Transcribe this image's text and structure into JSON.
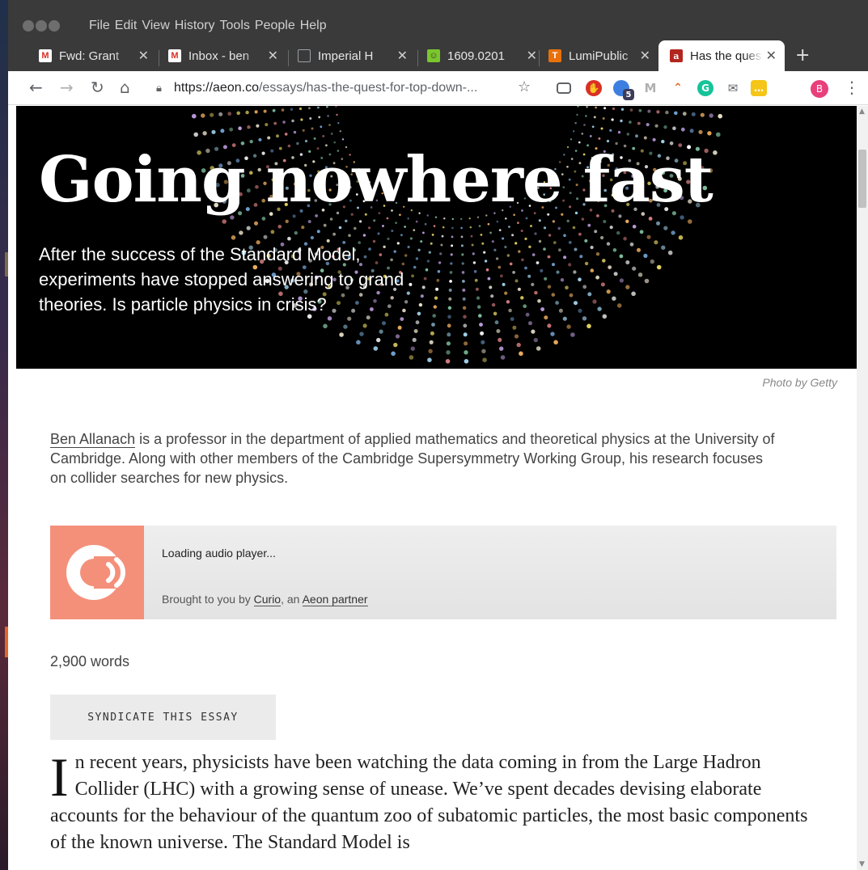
{
  "menu": [
    "File",
    "Edit",
    "View",
    "History",
    "Tools",
    "People",
    "Help"
  ],
  "tabs": [
    {
      "title": "Fwd: Grant",
      "icon": "gmail-icon",
      "color": "#d93025",
      "glyph": "M"
    },
    {
      "title": "Inbox - ben",
      "icon": "gmail-icon",
      "color": "#d93025",
      "glyph": "M"
    },
    {
      "title": "Imperial H",
      "icon": "document-icon",
      "color": "#9aa0a6",
      "glyph": ""
    },
    {
      "title": "1609.0201",
      "icon": "smiley-icon",
      "color": "#7bc62d",
      "glyph": ""
    },
    {
      "title": "LumiPublic",
      "icon": "lumi-icon",
      "color": "#e8710a",
      "glyph": "T"
    },
    {
      "title": "Has the quest",
      "icon": "aeon-icon",
      "color": "#b3261e",
      "glyph": "a"
    }
  ],
  "url": {
    "host": "https://aeon.co",
    "path": "/essays/has-the-quest-for-top-down-..."
  },
  "profile_initial": "B",
  "extensions_badge": "5",
  "hero": {
    "title": "Going nowhere fast",
    "subtitle": "After the success of the Standard Model, experiments have stopped answering to grand theories. Is particle physics in crisis?"
  },
  "photo_credit": "Photo by Getty",
  "bio": {
    "author": "Ben Allanach",
    "text": " is a professor in the department of applied mathematics and theoretical physics at the University of Cambridge. Along with other members of the Cambridge Supersymmetry Working Group, his research focuses on collider searches for new physics."
  },
  "audio": {
    "loading": "Loading audio player...",
    "credit_prefix": "Brought to you by ",
    "credit_curio": "Curio",
    "credit_mid": ", an ",
    "credit_partner": "Aeon partner",
    "logo_color": "#f4907a"
  },
  "word_count": "2,900 words",
  "syndicate_label": "SYNDICATE THIS ESSAY",
  "essay": {
    "dropcap": "I",
    "text": "n recent years, physicists have been watching the data coming in from the Large Hadron Collider (LHC) with a growing sense of unease. We’ve spent decades devising elaborate accounts for the behaviour of the quantum zoo of subatomic particles, the most basic components of the known universe. The Standard Model is"
  }
}
